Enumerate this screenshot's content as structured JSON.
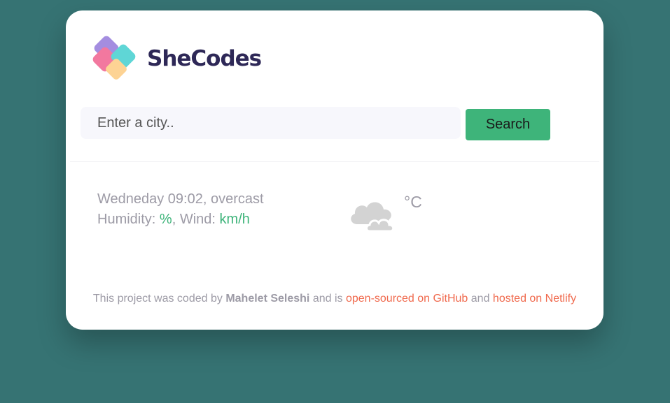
{
  "brand": {
    "name": "SheCodes",
    "logo_colors": [
      "#a48de0",
      "#f2789f",
      "#5fd6d6",
      "#fdd394"
    ]
  },
  "search": {
    "placeholder": "Enter a city..",
    "value": "",
    "button_label": "Search"
  },
  "current": {
    "day_time": "Wedneday 09:02",
    "description": "overcast",
    "humidity_label": "Humidity:",
    "humidity_value": "",
    "humidity_unit": "%",
    "wind_label": "Wind:",
    "wind_value": "",
    "wind_unit": "km/h",
    "icon": "cloud-icon",
    "temperature": "",
    "temperature_unit": "°C"
  },
  "footer": {
    "prefix": "This project was coded by",
    "author": "Mahelet Seleshi",
    "middle": "and is",
    "github_link": "open-sourced on GitHub",
    "and": "and",
    "netlify_link": "hosted on Netlify"
  },
  "colors": {
    "background": "#367373",
    "accent": "#3eb47a",
    "link": "#f06a4e",
    "muted_text": "#9d9ba6"
  }
}
